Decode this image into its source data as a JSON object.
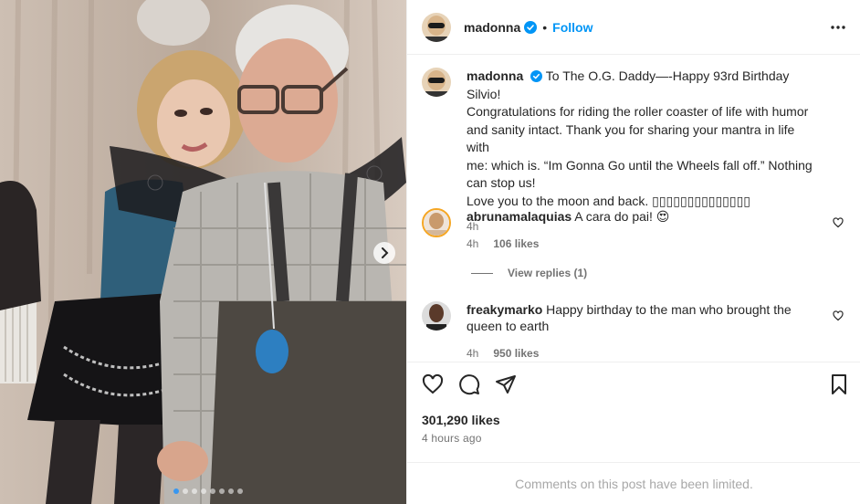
{
  "post": {
    "author": "madonna",
    "follow_label": "Follow",
    "separator": "•",
    "carousel_slides": 8,
    "carousel_active_index": 0
  },
  "caption": {
    "username": "madonna",
    "text_lines": [
      "To The O.G. Daddy—-Happy 93rd Birthday Silvio!",
      "Congratulations for riding the roller coaster of life with humor",
      "and sanity intact. Thank you for sharing your mantra in life with",
      "me: which is. “Im Gonna Go until the Wheels fall off.” Nothing",
      "can stop us!",
      "Love you to the moon and back. ▯▯▯▯▯▯▯▯▯▯▯▯▯▯"
    ],
    "time": "4h"
  },
  "comments": [
    {
      "username": "abrunamalaquias",
      "text": "A cara do pai! 😍",
      "time": "4h",
      "likes": "106 likes",
      "view_replies": "View replies (1)"
    },
    {
      "username": "freakymarko",
      "text": "Happy birthday to the man who brought the queen to earth",
      "time": "4h",
      "likes": "950 likes"
    }
  ],
  "footer": {
    "likes": "301,290 likes",
    "time": "4 hours ago",
    "limited_notice": "Comments on this post have been limited."
  },
  "colors": {
    "accent": "#0095f6",
    "verified": "#0095f6",
    "secondary_text": "#737373",
    "border": "#efefef"
  },
  "icons": [
    "verified-badge-icon",
    "more-options-icon",
    "heart-icon",
    "comment-icon",
    "share-icon",
    "bookmark-icon",
    "chevron-right-icon"
  ]
}
